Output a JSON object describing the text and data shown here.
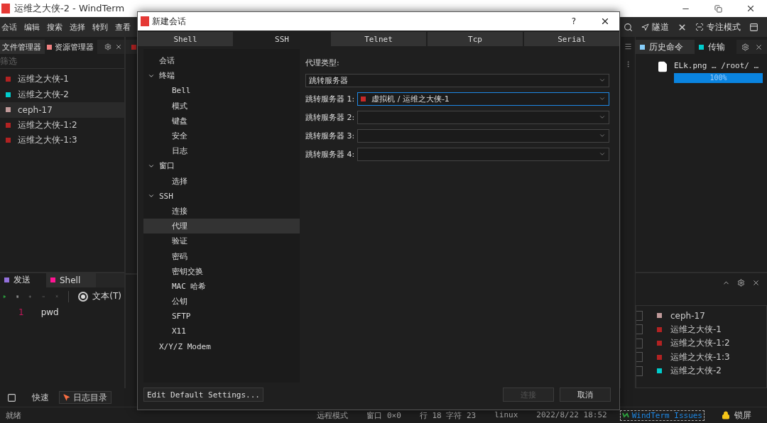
{
  "window": {
    "title": "运维之大侠-2 - WindTerm"
  },
  "menu": [
    "会话",
    "编辑",
    "搜索",
    "选择",
    "转到",
    "查看"
  ],
  "toolbar_right": [
    "隧道",
    "专注模式"
  ],
  "left_panel": {
    "tabs": [
      {
        "label": "文件管理器",
        "selected": false
      },
      {
        "label": "资源管理器",
        "selected": true,
        "color": "#f08080"
      }
    ],
    "filter": {
      "placeholder": "筛选"
    },
    "sessions": [
      {
        "name": "运维之大侠-1",
        "color": "#b22222",
        "selected": false
      },
      {
        "name": "运维之大侠-2",
        "color": "#00cccc",
        "selected": false
      },
      {
        "name": "ceph-17",
        "color": "#c09a9a",
        "selected": true
      },
      {
        "name": "运维之大侠-1:2",
        "color": "#b22222",
        "selected": false
      },
      {
        "name": "运维之大侠-1:3",
        "color": "#b22222",
        "selected": false
      }
    ]
  },
  "send_panel": {
    "tabs": [
      {
        "label": "发送",
        "color": "#9370db",
        "selected": true
      },
      {
        "label": "Shell",
        "color": "#ff1493",
        "selected": false
      }
    ],
    "mode": {
      "label": "文本(T)",
      "checked": true
    },
    "lines": [
      {
        "number": "1",
        "text": "pwd"
      }
    ]
  },
  "bottom_bar": {
    "label": "快速",
    "log_button": "日志目录"
  },
  "right_panel": {
    "tabs": [
      {
        "label": "历史命令",
        "color": "#87cefa",
        "selected": false
      },
      {
        "label": "传输",
        "color": "#00cccc",
        "selected": true
      }
    ],
    "transfers": [
      {
        "name": "ELk.png … /root/ …",
        "level": 1,
        "reading": "100%"
      }
    ],
    "sessions": [
      {
        "name": "ceph-17",
        "color": "#c09a9a",
        "checked": false
      },
      {
        "name": "运维之大侠-1",
        "color": "#b22222",
        "checked": false
      },
      {
        "name": "运维之大侠-1:2",
        "color": "#b22222",
        "checked": false
      },
      {
        "name": "运维之大侠-1:3",
        "color": "#b22222",
        "checked": false
      },
      {
        "name": "运维之大侠-2",
        "color": "#00cccc",
        "checked": false
      }
    ]
  },
  "status_bar": {
    "state": "就绪",
    "items": [
      "远程模式",
      "窗口 0×0",
      "行 18 字符 23",
      "linux",
      "2022/8/22 18:52"
    ],
    "link": "WindTerm Issues",
    "lock": "锁屏"
  },
  "dialog": {
    "title": "新建会话",
    "help": "?",
    "tabs": [
      {
        "label": "Shell",
        "selected": false
      },
      {
        "label": "SSH",
        "selected": true
      },
      {
        "label": "Telnet",
        "selected": false
      },
      {
        "label": "Tcp",
        "selected": false
      },
      {
        "label": "Serial",
        "selected": false
      }
    ],
    "tree": [
      {
        "label": "会话",
        "selected": false
      },
      {
        "label": "终端",
        "selected": false,
        "expanded": true,
        "children": [
          {
            "label": "Bell",
            "selected": false
          },
          {
            "label": "模式",
            "selected": false
          },
          {
            "label": "键盘",
            "selected": false
          },
          {
            "label": "安全",
            "selected": false
          },
          {
            "label": "日志",
            "selected": false
          }
        ]
      },
      {
        "label": "窗口",
        "selected": false,
        "expanded": true,
        "children": [
          {
            "label": "选择",
            "selected": false
          }
        ]
      },
      {
        "label": "SSH",
        "selected": false,
        "expanded": true,
        "children": [
          {
            "label": "连接",
            "selected": false
          },
          {
            "label": "代理",
            "selected": true
          },
          {
            "label": "验证",
            "selected": false
          },
          {
            "label": "密码",
            "selected": false
          },
          {
            "label": "密钥交换",
            "selected": false
          },
          {
            "label": "MAC 哈希",
            "selected": false
          },
          {
            "label": "公钥",
            "selected": false
          },
          {
            "label": "SFTP",
            "selected": false
          },
          {
            "label": "X11",
            "selected": false
          }
        ]
      },
      {
        "label": "X/Y/Z Modem",
        "selected": false
      }
    ],
    "proxy_type": {
      "label": "代理类型:",
      "value": "跳转服务器"
    },
    "jump_servers": [
      {
        "label": "跳转服务器 1:",
        "value": "虚拟机 / 运维之大侠-1",
        "color": "#c62828",
        "focused": true
      },
      {
        "label": "跳转服务器 2:",
        "focused": false
      },
      {
        "label": "跳转服务器 3:",
        "focused": false
      },
      {
        "label": "跳转服务器 4:",
        "focused": false
      }
    ],
    "edit_defaults": "Edit Default Settings...",
    "buttons": [
      {
        "label": "连接",
        "disabled": true
      },
      {
        "label": "取消",
        "disabled": false
      }
    ]
  }
}
